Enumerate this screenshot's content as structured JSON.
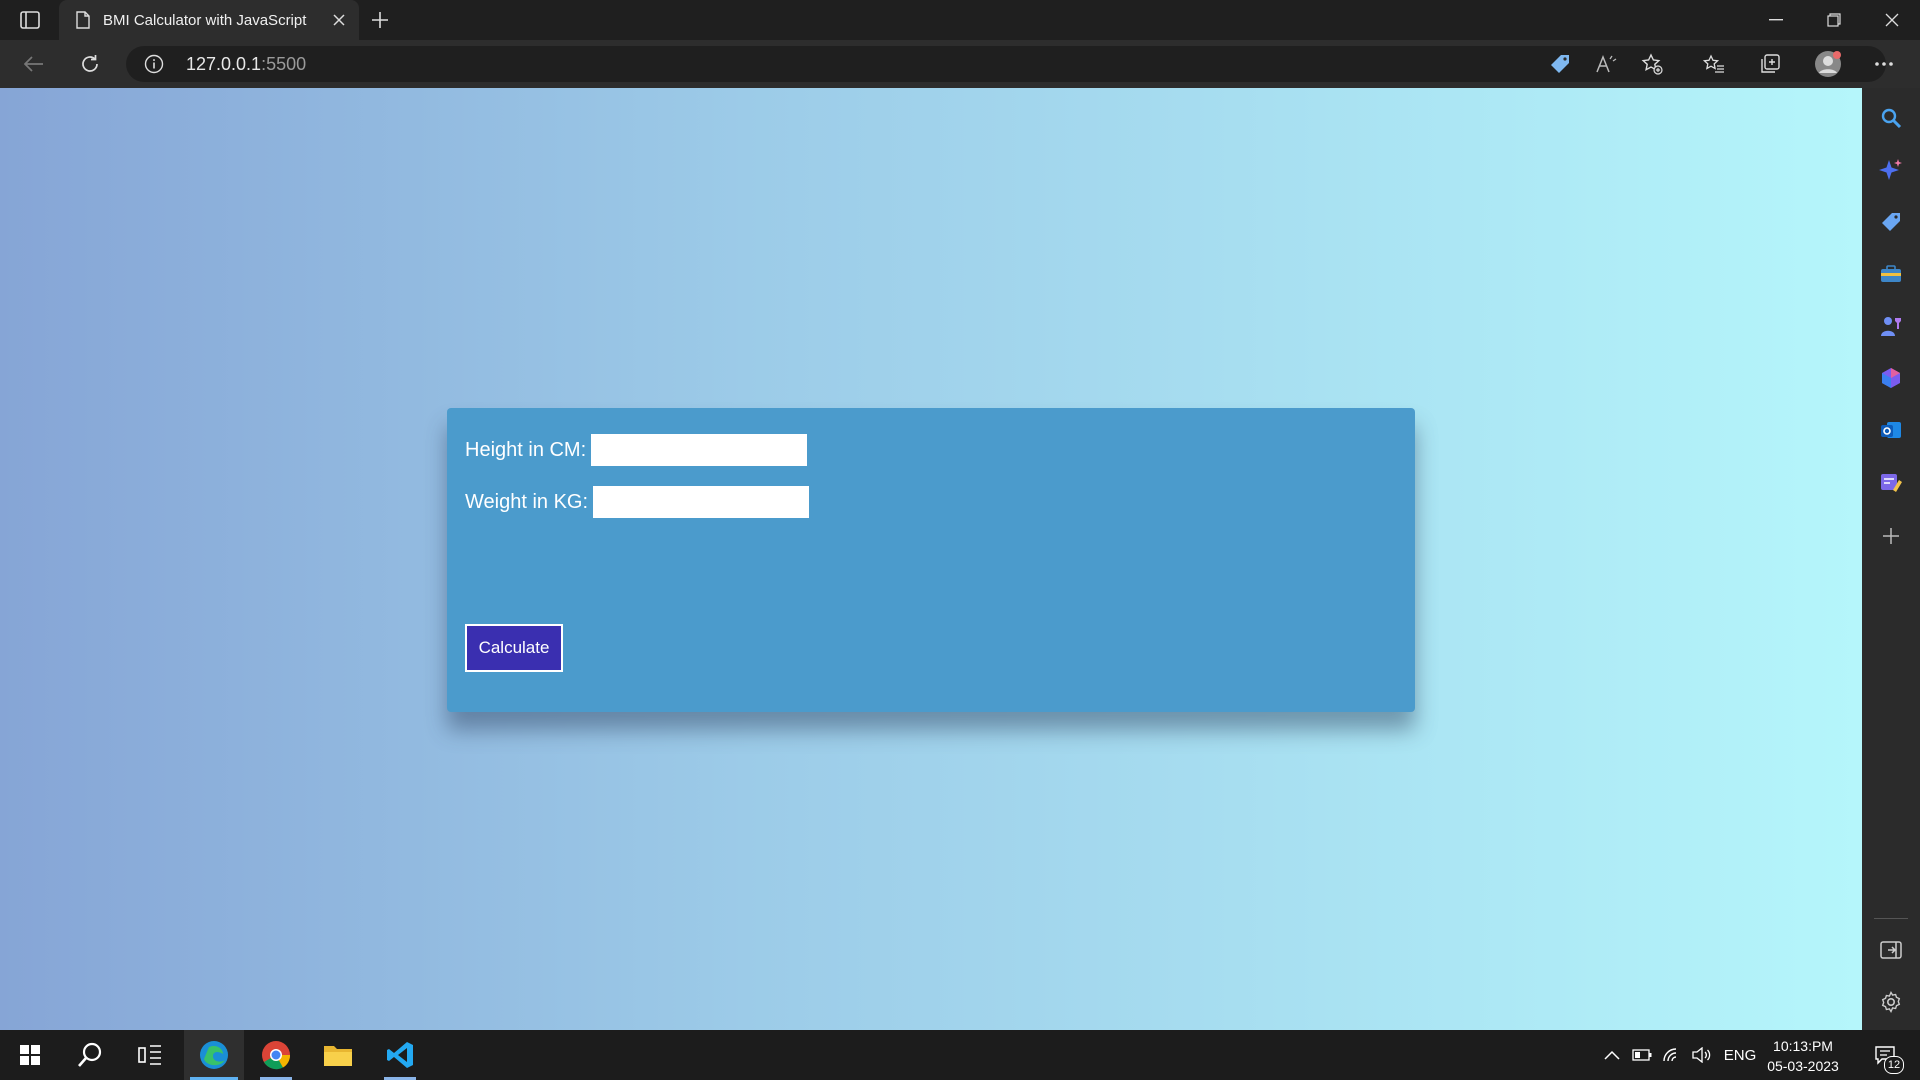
{
  "browser": {
    "tab_title": "BMI Calculator with JavaScript",
    "url_host": "127.0.0.1",
    "url_port": ":5500"
  },
  "page": {
    "height_label": "Height in CM:",
    "height_value": "",
    "weight_label": "Weight in KG:",
    "weight_value": "",
    "calculate_label": "Calculate",
    "result_text": ""
  },
  "taskbar": {
    "language": "ENG",
    "time": "10:13:PM",
    "date": "05-03-2023",
    "notification_count": "12"
  },
  "colors": {
    "card_bg": "#4b9bcc",
    "button_bg": "#3a2fb0",
    "gradient_start": "#86a5d6",
    "gradient_end": "#b5f6fb",
    "taskbar_accent": "#5fb2f2"
  }
}
